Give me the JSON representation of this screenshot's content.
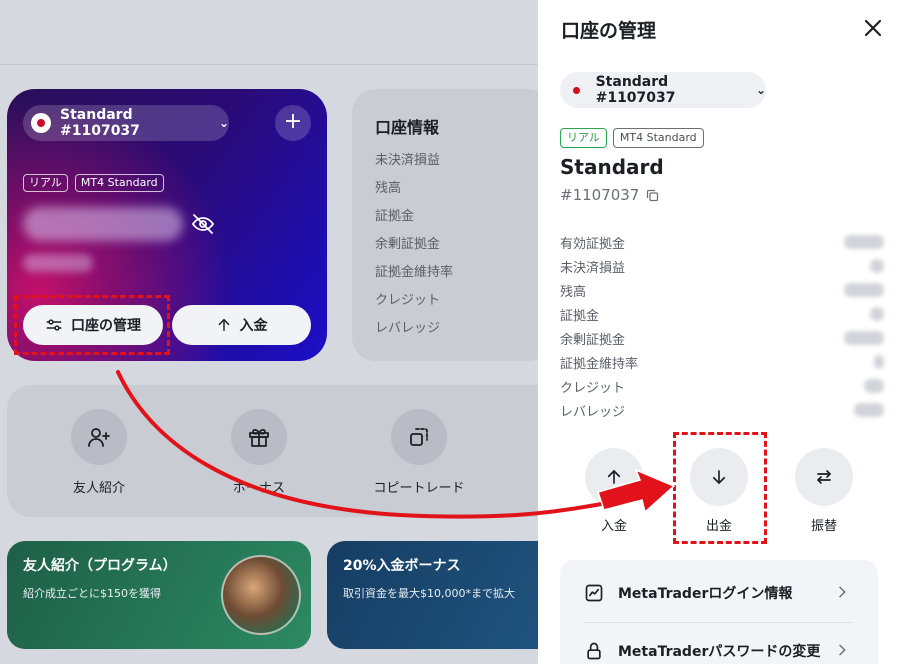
{
  "dashboard": {
    "account_selector": "Standard #1107037",
    "tags": [
      "リアル",
      "MT4 Standard"
    ],
    "manage_button": "口座の管理",
    "deposit_button": "入金",
    "info": {
      "title": "口座情報",
      "rows": [
        "未決済損益",
        "残高",
        "証拠金",
        "余剰証拠金",
        "証拠金維持率",
        "クレジット",
        "レバレッジ"
      ]
    },
    "quick_actions": [
      {
        "label": "友人紹介",
        "icon": "user-plus-icon"
      },
      {
        "label": "ボーナス",
        "icon": "gift-icon"
      },
      {
        "label": "コピートレード",
        "icon": "copy-trade-icon"
      }
    ],
    "promos": [
      {
        "title": "友人紹介（プログラム）",
        "subtitle": "紹介成立ごとに$150を獲得"
      },
      {
        "title": "20%入金ボーナス",
        "subtitle": "取引資金を最大$10,000*まで拡大"
      }
    ]
  },
  "panel": {
    "title": "口座の管理",
    "account_selector": "Standard #1107037",
    "tags": [
      "リアル",
      "MT4 Standard"
    ],
    "account_name": "Standard",
    "account_number": "#1107037",
    "rows": [
      "有効証拠金",
      "未決済損益",
      "残高",
      "証拠金",
      "余剰証拠金",
      "証拠金維持率",
      "クレジット",
      "レバレッジ"
    ],
    "actions": [
      {
        "label": "入金",
        "icon": "arrow-up-icon"
      },
      {
        "label": "出金",
        "icon": "arrow-down-icon"
      },
      {
        "label": "振替",
        "icon": "transfer-icon"
      }
    ],
    "menu": [
      {
        "label": "MetaTraderログイン情報",
        "icon": "chart-icon"
      },
      {
        "label": "MetaTraderパスワードの変更",
        "icon": "lock-icon"
      }
    ]
  },
  "colors": {
    "highlight": "#e2121a",
    "accent_green": "#2a9a4a",
    "flag_red": "#c8102e"
  }
}
